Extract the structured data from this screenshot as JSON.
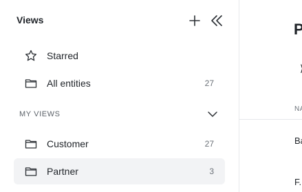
{
  "sidebar": {
    "title": "Views",
    "icons": {
      "add": "plus-icon",
      "collapse": "double-chevron-left-icon"
    },
    "items": [
      {
        "label": "Starred",
        "icon": "star-icon",
        "count": ""
      },
      {
        "label": "All entities",
        "icon": "folder-icon",
        "count": "27"
      }
    ],
    "section": {
      "label": "MY VIEWS",
      "icon": "chevron-down-icon",
      "items": [
        {
          "label": "Customer",
          "icon": "folder-icon",
          "count": "27",
          "active": false
        },
        {
          "label": "Partner",
          "icon": "folder-icon",
          "count": "3",
          "active": true
        }
      ]
    }
  },
  "main": {
    "title": "P",
    "toolbar_glyph": "⟩",
    "column_header": "NA",
    "rows": [
      {
        "name": "Ba"
      },
      {
        "name": "F."
      }
    ]
  },
  "colors": {
    "active_item_bg": "#f2f3f5",
    "divider": "#e6e8eb",
    "muted_text": "#6b7178"
  }
}
